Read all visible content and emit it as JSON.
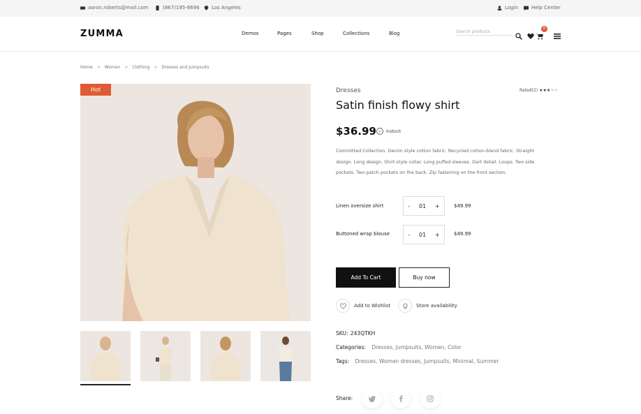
{
  "topbar": {
    "email": "aaron.roberts@mail.com",
    "phone": "(867)195-6696",
    "location": "Los Angeles",
    "login": "Login",
    "help": "Help Center"
  },
  "header": {
    "logo": "ZUMMA",
    "nav": [
      "Demos",
      "Pages",
      "Shop",
      "Collections",
      "Blog"
    ],
    "search_placeholder": "Search products",
    "cart_count": "0"
  },
  "breadcrumb": [
    "Home",
    "Women",
    "Clothing",
    "Dresses and Jumpsuits"
  ],
  "gallery": {
    "badge": "Hot"
  },
  "product": {
    "category": "Dresses",
    "rated_label": "Rated(2)",
    "rating": 3,
    "rating_max": 5,
    "title": "Satin finish flowy shirt",
    "price": "$36.99",
    "stock": "Instock",
    "description": "Committed Collection. Denim style cotton fabric. Recycled cotton-blend fabric. Straight design. Long design. Shirt-style collar. Long puffed sleeves. Dart detail. Loops. Two side pockets. Two patch pockets on the back. Zip fastening on the front section.",
    "bundle": [
      {
        "name": "Linen oversize shirt",
        "qty": "01",
        "price": "$49.99"
      },
      {
        "name": "Buttoned wrap blouse",
        "qty": "01",
        "price": "$49.99"
      }
    ],
    "add_to_cart": "Add To Cart",
    "buy_now": "Buy now",
    "wishlist": "Add to Wishlist",
    "store": "Store availability",
    "sku_label": "SKU:",
    "sku": "243QTKH",
    "categories_label": "Categories:",
    "categories": "Dresses, Jumpsuits, Women, Color",
    "tags_label": "Tags:",
    "tags": "Dresses, Women dresses, Jumpsuits, Minimal, Summer",
    "share_label": "Share:"
  },
  "colors": {
    "accent": "#e05a33",
    "dark": "#111111"
  }
}
